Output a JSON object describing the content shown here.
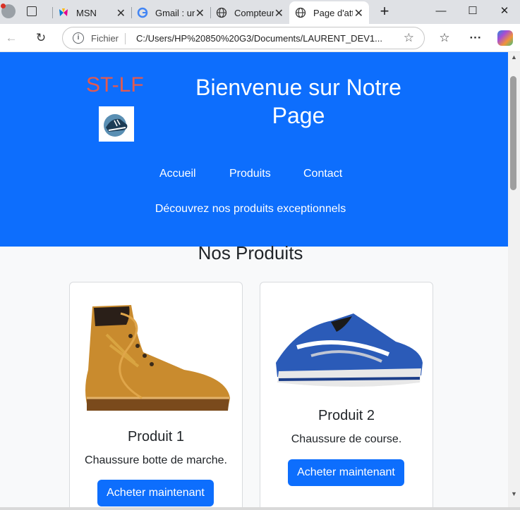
{
  "browser": {
    "tabs": [
      {
        "title": "MSN",
        "icon": "msn-butterfly-icon"
      },
      {
        "title": "Gmail : un",
        "icon": "google-g-icon"
      },
      {
        "title": "Compteur",
        "icon": "globe-icon"
      },
      {
        "title": "Page d'att",
        "icon": "globe-icon"
      }
    ],
    "address": {
      "scheme": "Fichier",
      "url": "C:/Users/HP%20850%20G3/Documents/LAURENT_DEV1..."
    }
  },
  "page": {
    "brand": "ST-LF",
    "headline": "Bienvenue sur Notre Page",
    "nav": [
      "Accueil",
      "Produits",
      "Contact"
    ],
    "tagline": "Découvrez nos produits exceptionnels",
    "section_title": "Nos Produits",
    "products": [
      {
        "title": "Produit 1",
        "description": "Chaussure botte de marche.",
        "button": "Acheter maintenant"
      },
      {
        "title": "Produit 2",
        "description": "Chaussure de course.",
        "button": "Acheter maintenant"
      }
    ]
  },
  "colors": {
    "header_bg": "#0d6efd",
    "brand": "#e35a4f",
    "button": "#0d6efd"
  }
}
